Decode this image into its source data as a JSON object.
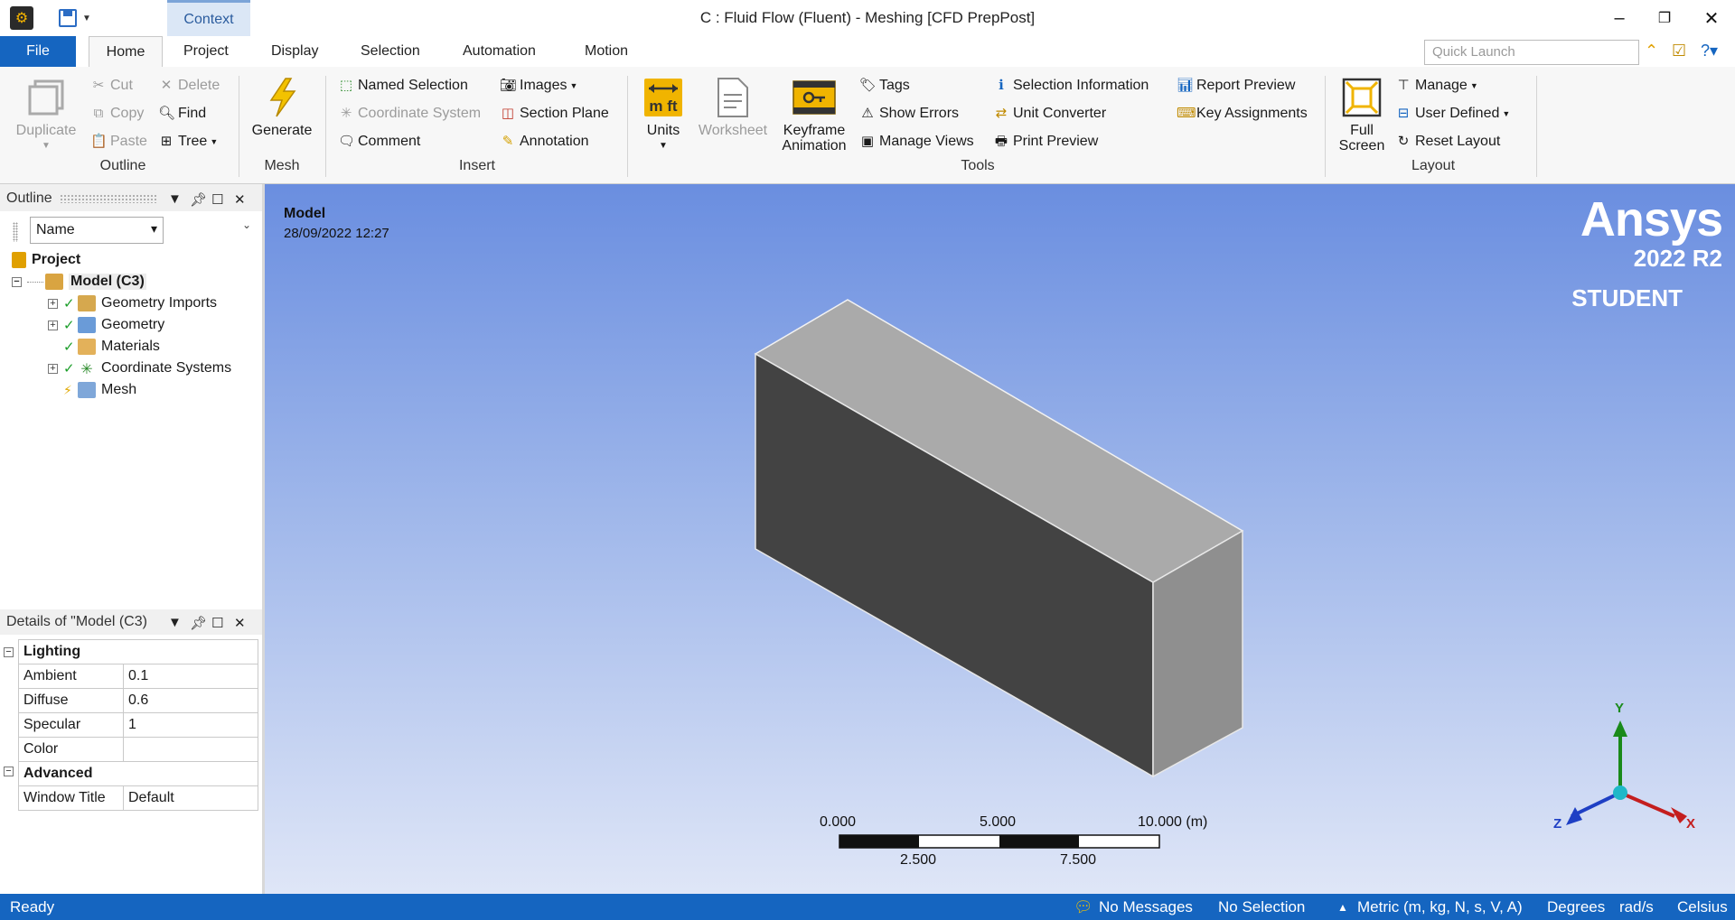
{
  "titlebar": {
    "context_tab": "Context",
    "window_title": "C : Fluid Flow (Fluent) - Meshing [CFD PrepPost]"
  },
  "tabs": {
    "file": "File",
    "home": "Home",
    "project": "Project",
    "display": "Display",
    "selection": "Selection",
    "automation": "Automation",
    "motion": "Motion"
  },
  "quick_launch": {
    "placeholder": "Quick Launch"
  },
  "ribbon": {
    "outline_group": {
      "label": "Outline",
      "duplicate": "Duplicate",
      "cut": "Cut",
      "copy": "Copy",
      "paste": "Paste",
      "delete": "Delete",
      "find": "Find",
      "tree": "Tree"
    },
    "mesh_group": {
      "label": "Mesh",
      "generate": "Generate"
    },
    "insert_group": {
      "label": "Insert",
      "named_selection": "Named Selection",
      "coordinate_system": "Coordinate System",
      "comment": "Comment",
      "images": "Images",
      "section_plane": "Section Plane",
      "annotation": "Annotation"
    },
    "tools_group": {
      "label": "Tools",
      "units": "Units",
      "worksheet": "Worksheet",
      "keyframe_line1": "Keyframe",
      "keyframe_line2": "Animation",
      "tags": "Tags",
      "show_errors": "Show Errors",
      "manage_views": "Manage Views",
      "selection_information": "Selection Information",
      "unit_converter": "Unit Converter",
      "print_preview": "Print Preview",
      "report_preview": "Report Preview",
      "key_assignments": "Key Assignments"
    },
    "layout_group": {
      "label": "Layout",
      "full_line1": "Full",
      "full_line2": "Screen",
      "manage": "Manage",
      "user_defined": "User Defined",
      "reset_layout": "Reset Layout"
    }
  },
  "outline": {
    "title": "Outline",
    "name_filter": "Name",
    "tree": {
      "project": "Project",
      "model": "Model (C3)",
      "geometry_imports": "Geometry Imports",
      "geometry": "Geometry",
      "materials": "Materials",
      "coordinate_systems": "Coordinate Systems",
      "mesh": "Mesh"
    }
  },
  "details": {
    "title": "Details of \"Model (C3)",
    "categories": {
      "lighting": "Lighting",
      "advanced": "Advanced"
    },
    "rows": {
      "ambient": {
        "label": "Ambient",
        "value": "0.1"
      },
      "diffuse": {
        "label": "Diffuse",
        "value": "0.6"
      },
      "specular": {
        "label": "Specular",
        "value": "1"
      },
      "color": {
        "label": "Color",
        "value": ""
      },
      "window_title": {
        "label": "Window Title",
        "value": "Default"
      }
    }
  },
  "viewport": {
    "model_label": "Model",
    "date": "28/09/2022 12:27",
    "brand": {
      "name": "Ansys",
      "version": "2022 R2",
      "edition": "STUDENT"
    },
    "scale": {
      "top_left": "0.000",
      "top_mid": "5.000",
      "top_right": "10.000 (m)",
      "bottom_left": "2.500",
      "bottom_right": "7.500"
    },
    "triad": {
      "x": "X",
      "y": "Y",
      "z": "Z"
    }
  },
  "status": {
    "ready": "Ready",
    "messages": "No Messages",
    "selection": "No Selection",
    "units": "Metric (m, kg, N, s, V, A)",
    "angle": "Degrees",
    "angular_velocity": "rad/s",
    "temperature": "Celsius"
  },
  "colors": {
    "accent_blue": "#1565c0",
    "viewport_top": "#6a8ee0",
    "viewport_bottom": "#dfe6f7",
    "box_front": "#434343",
    "box_top": "#aaaaaa",
    "box_side": "#8f8f8f"
  }
}
